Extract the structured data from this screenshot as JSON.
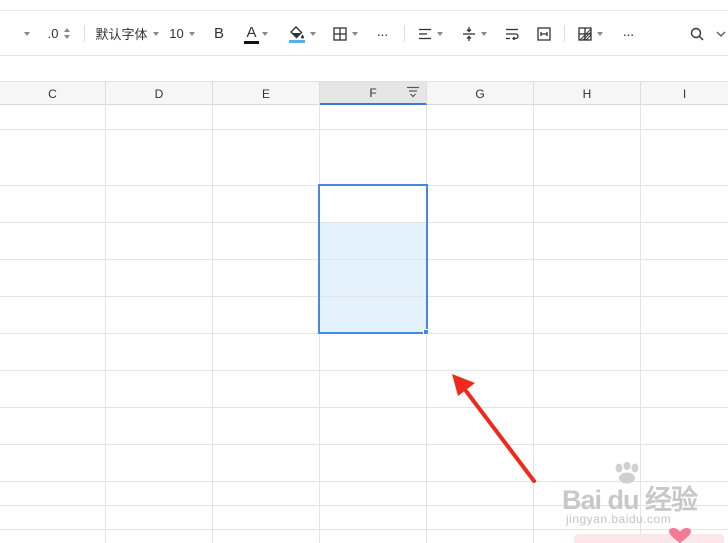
{
  "toolbar": {
    "decimal_label": ".0",
    "font_name": "默认字体",
    "font_size": "10",
    "bold_label": "B",
    "font_color_label": "A",
    "more_label_1": "···",
    "more_label_2": "···"
  },
  "columns": [
    "C",
    "D",
    "E",
    "F",
    "G",
    "H",
    "I"
  ],
  "selected_column": "F",
  "colors": {
    "selection_border": "#4a87e0",
    "selection_fill": "#e3f2fc",
    "fill_color_bar": "#5aaee6",
    "arrow": "#ee2a1f"
  },
  "watermark": {
    "main": "Bai du 经验",
    "sub": "jingyan.baidu.com"
  }
}
